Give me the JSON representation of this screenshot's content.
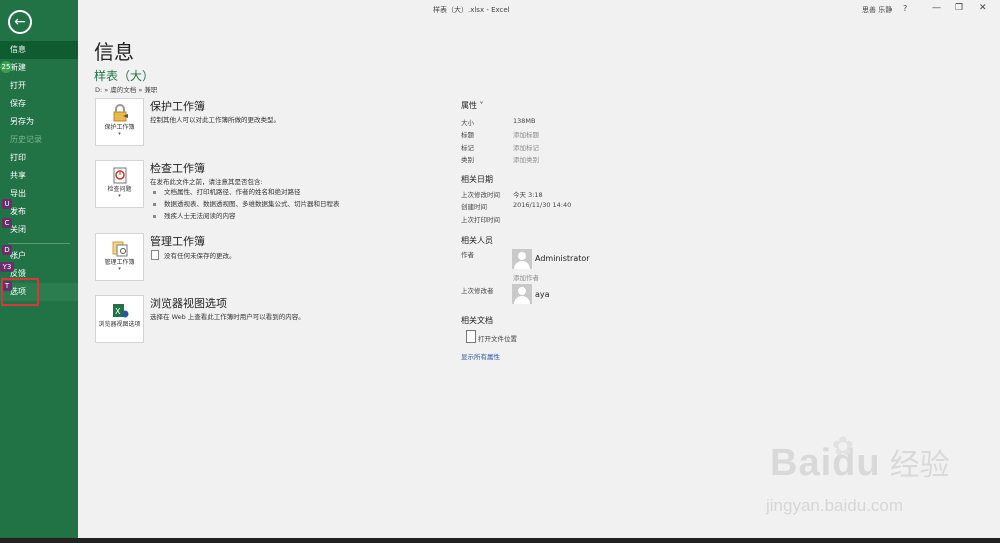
{
  "window": {
    "title": "样表（大）.xlsx - Excel",
    "user": "思善 乐静",
    "help": "?",
    "minimize": "—",
    "restore": "❐",
    "close": "✕"
  },
  "sidebar": {
    "back_icon": "left-arrow-icon",
    "items": [
      {
        "label": "信息",
        "state": "active"
      },
      {
        "label": "新建",
        "state": "normal"
      },
      {
        "label": "打开",
        "state": "normal"
      },
      {
        "label": "保存",
        "state": "normal"
      },
      {
        "label": "另存为",
        "state": "normal"
      },
      {
        "label": "历史记录",
        "state": "disabled"
      },
      {
        "label": "打印",
        "state": "normal"
      },
      {
        "label": "共享",
        "state": "normal"
      },
      {
        "label": "导出",
        "state": "normal"
      },
      {
        "label": "发布",
        "state": "normal"
      },
      {
        "label": "关闭",
        "state": "normal"
      },
      {
        "label": "帐户",
        "state": "normal"
      },
      {
        "label": "反馈",
        "state": "normal"
      },
      {
        "label": "选项",
        "state": "highlighted"
      }
    ],
    "key_tips": [
      "25",
      "U",
      "C",
      "D",
      "Y3",
      "T"
    ]
  },
  "main": {
    "title": "信息",
    "file_name": "样表（大）",
    "file_path": "D: » 虞的文档 » 兼职",
    "cards": [
      {
        "tile_label": "保护工作簿",
        "title": "保护工作簿",
        "desc": "控制其他人可以对此工作簿所做的更改类型。",
        "icon": "lock-icon"
      },
      {
        "tile_label": "检查问题",
        "title": "检查工作簿",
        "desc": "在发布此文件之前，请注意其是否包含:",
        "bullets": [
          "文档属性、打印机路径、作者的姓名和绝对路径",
          "数据透视表、数据透视图、多维数据集公式、切片器和日程表",
          "残疾人士无法阅读的内容"
        ],
        "icon": "inspect-icon"
      },
      {
        "tile_label": "管理工作簿",
        "title": "管理工作簿",
        "desc": "没有任何未保存的更改。",
        "icon": "manage-workbook-icon"
      },
      {
        "tile_label": "浏览器视图选项",
        "title": "浏览器视图选项",
        "desc": "选择在 Web 上查看此工作簿时用户可以看到的内容。",
        "icon": "browser-view-icon"
      }
    ]
  },
  "properties": {
    "heading": "属性 ˅",
    "rows": [
      {
        "label": "大小",
        "value": "138MB"
      },
      {
        "label": "标题",
        "value": "添加标题"
      },
      {
        "label": "标记",
        "value": "添加标记"
      },
      {
        "label": "类别",
        "value": "添加类别"
      }
    ],
    "dates_heading": "相关日期",
    "dates": [
      {
        "label": "上次修改时间",
        "value": "今天 3:18"
      },
      {
        "label": "创建时间",
        "value": "2016/11/30 14:40"
      },
      {
        "label": "上次打印时间",
        "value": ""
      }
    ],
    "people_heading": "相关人员",
    "author_label": "作者",
    "author_name": "Administrator",
    "add_author": "添加作者",
    "last_modified_by_label": "上次修改者",
    "last_modified_by": "aya",
    "docs_heading": "相关文档",
    "open_location": "打开文件位置",
    "show_all": "显示所有属性"
  },
  "watermark": {
    "brand": "Baidu",
    "brand_cn": "经验",
    "url": "jingyan.baidu.com"
  },
  "colors": {
    "sidebar": "#217346",
    "accent_text": "#217346",
    "link": "#2b579a",
    "highlight_box": "#d9363e"
  }
}
